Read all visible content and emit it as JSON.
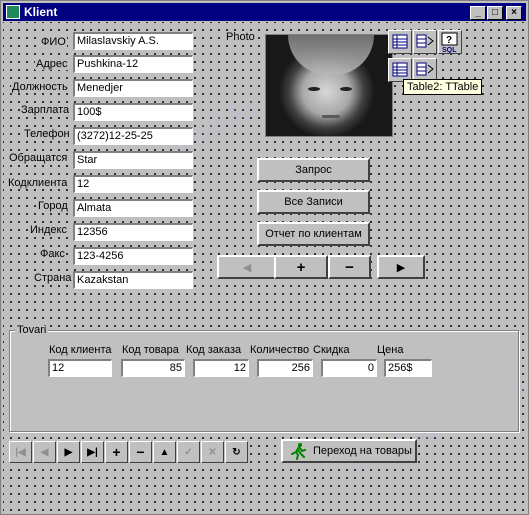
{
  "window": {
    "title": "Klient"
  },
  "fields": [
    {
      "label": "ФИО",
      "value": "Milaslavskiy A.S."
    },
    {
      "label": "Адрес",
      "value": "Pushkina-12"
    },
    {
      "label": "Должность",
      "value": "Menedjer"
    },
    {
      "label": "Зарплата",
      "value": "100$"
    },
    {
      "label": "Телефон",
      "value": "(3272)12-25-25"
    },
    {
      "label": "Обращатся",
      "value": "Star"
    },
    {
      "label": "Кодклиента",
      "value": "12"
    },
    {
      "label": "Город",
      "value": "Almata"
    },
    {
      "label": "Индекс",
      "value": "12356"
    },
    {
      "label": "Факс",
      "value": "123-4256"
    },
    {
      "label": "Страна",
      "value": "Kazakstan"
    }
  ],
  "photo": {
    "label": "Photo"
  },
  "components": {
    "tooltip": "Table2: TTable",
    "sql_label": "SQL"
  },
  "buttons": {
    "query": "Запрос",
    "all_records": "Все Записи",
    "report": "Отчет по клиентам",
    "goto_goods": "Переход на товары"
  },
  "tovari": {
    "title": "Tovari",
    "columns": [
      "Код клиента",
      "Код товара",
      "Код заказа",
      "Количество",
      "Скидка",
      "Цена"
    ],
    "values": [
      "12",
      "85",
      "12",
      "256",
      "0",
      "256$"
    ]
  },
  "watermark": "Stud.kz - Stud.kz"
}
